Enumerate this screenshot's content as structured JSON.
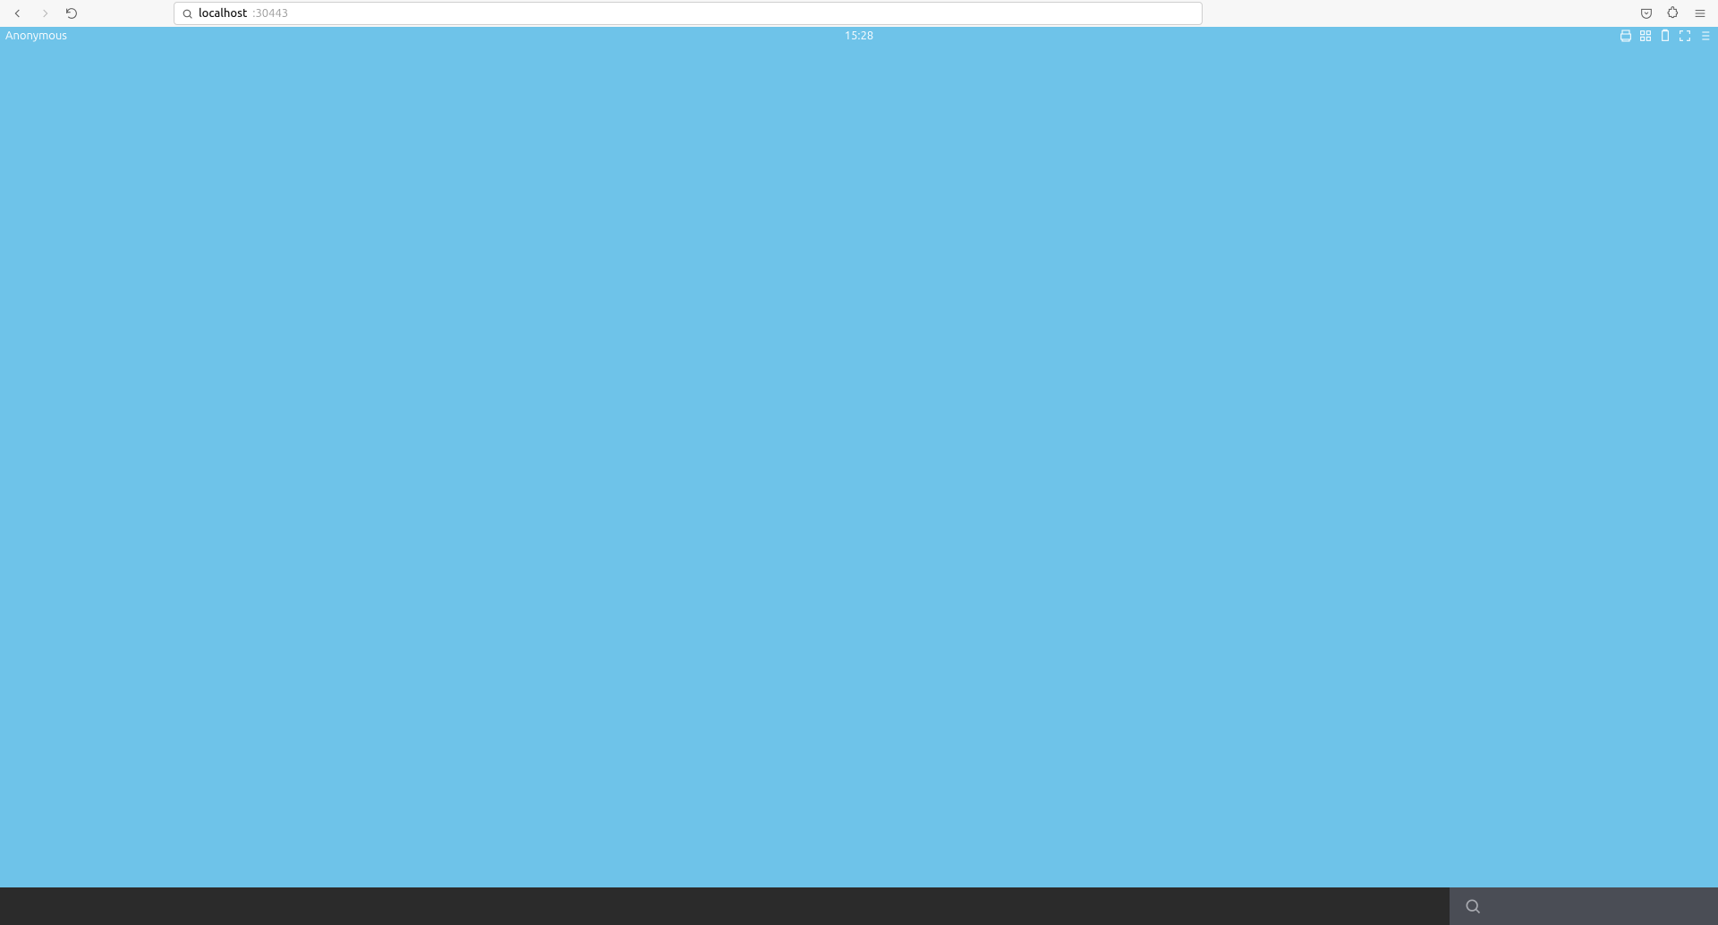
{
  "browser": {
    "url_host": "localhost",
    "url_port": ":30443"
  },
  "app": {
    "user_label": "Anonymous",
    "clock": "15:28"
  }
}
